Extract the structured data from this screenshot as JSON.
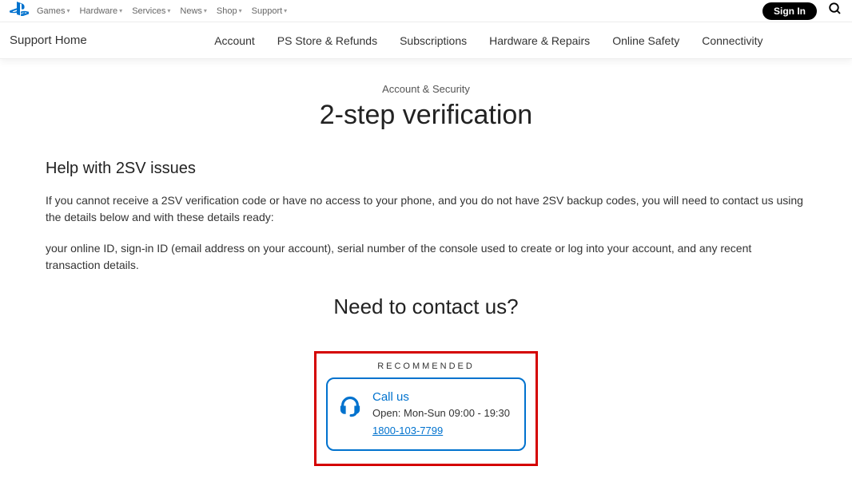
{
  "topNav": {
    "links": [
      "Games",
      "Hardware",
      "Services",
      "News",
      "Shop",
      "Support"
    ],
    "signIn": "Sign In"
  },
  "subNav": {
    "home": "Support Home",
    "links": [
      "Account",
      "PS Store & Refunds",
      "Subscriptions",
      "Hardware & Repairs",
      "Online Safety",
      "Connectivity"
    ]
  },
  "breadcrumb": "Account & Security",
  "pageTitle": "2-step verification",
  "section": {
    "heading": "Help with 2SV issues",
    "p1": "If you cannot receive a 2SV verification code or have no access to your phone, and you do not have 2SV backup codes, you will need to contact us using the details below and with these details ready:",
    "p2": "your online ID, sign-in ID (email address on your account), serial number of the console used to create or log into your account, and any recent transaction details."
  },
  "contact": {
    "heading": "Need to contact us?",
    "recommended": "RECOMMENDED",
    "callTitle": "Call us",
    "callHours": "Open: Mon-Sun 09:00 - 19:30",
    "callNumber": "1800-103-7799"
  }
}
